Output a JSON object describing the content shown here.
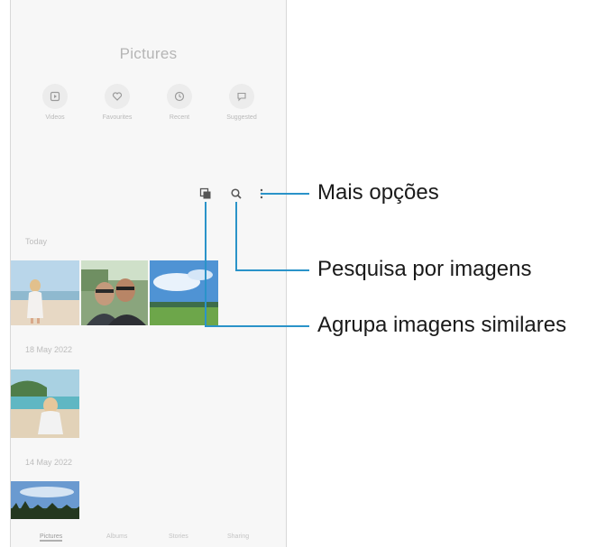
{
  "app": {
    "title": "Pictures",
    "quick_actions": [
      {
        "label": "Videos",
        "icon": "video-icon"
      },
      {
        "label": "Favourites",
        "icon": "heart-icon"
      },
      {
        "label": "Recent",
        "icon": "clock-icon"
      },
      {
        "label": "Suggested",
        "icon": "chat-icon"
      }
    ],
    "toolbar": {
      "group_icon": "group-similar-icon",
      "search_icon": "search-icon",
      "more_icon": "more-options-icon"
    },
    "sections": [
      "Today",
      "18 May 2022",
      "14 May 2022"
    ],
    "bottom_tabs": [
      "Pictures",
      "Albums",
      "Stories",
      "Sharing"
    ]
  },
  "callouts": {
    "more_options": "Mais opções",
    "search_images": "Pesquisa por imagens",
    "group_similar": "Agrupa imagens similares"
  },
  "colors": {
    "callout_line": "#2a93c9",
    "phone_bg": "#f7f7f7"
  }
}
